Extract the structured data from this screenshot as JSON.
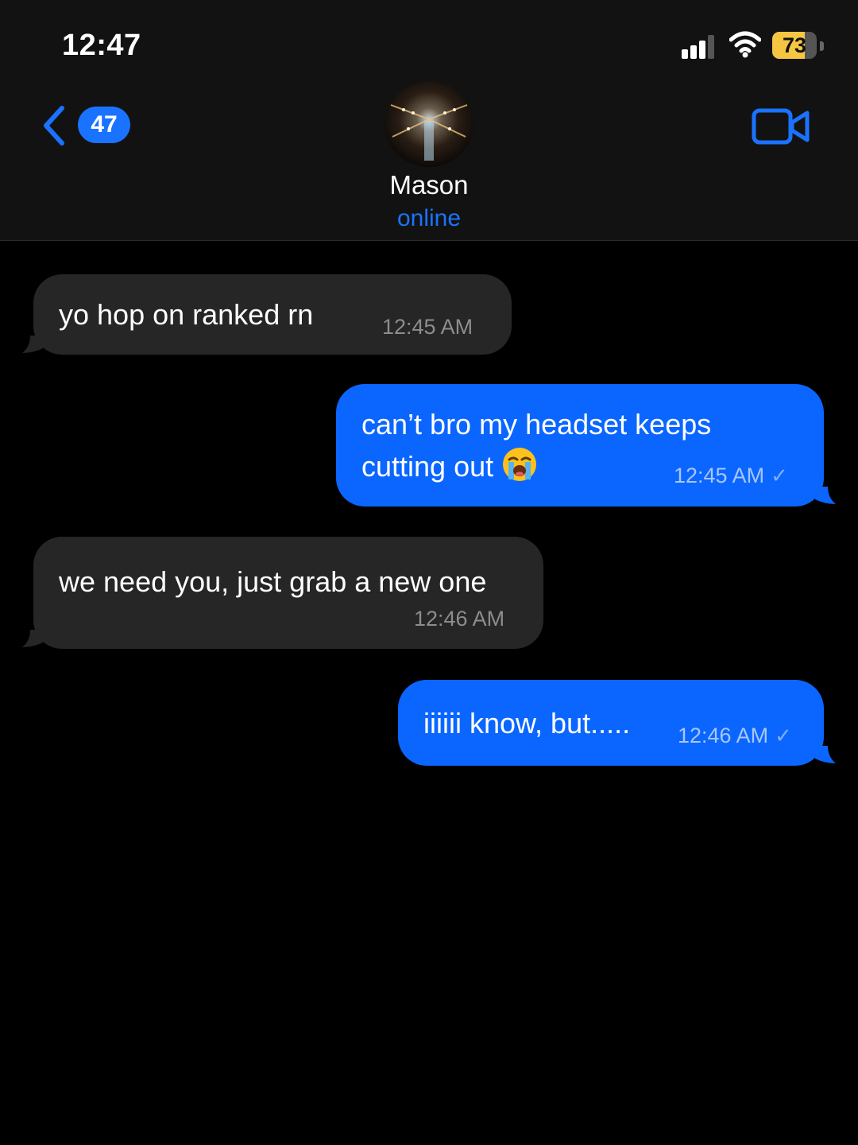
{
  "status_bar": {
    "time": "12:47",
    "battery_percent": "73"
  },
  "header": {
    "unread_count": "47",
    "contact_name": "Mason",
    "contact_status": "online"
  },
  "messages": [
    {
      "direction": "incoming",
      "text": "yo hop on ranked rn",
      "time": "12:45 AM"
    },
    {
      "direction": "outgoing",
      "text_line1": "can’t bro my headset keeps",
      "text_line2": "cutting out",
      "emoji": "loudly-crying-face",
      "time": "12:45 AM",
      "read_mark": "✓"
    },
    {
      "direction": "incoming",
      "text": "we need you, just grab a new one",
      "time": "12:46 AM"
    },
    {
      "direction": "outgoing",
      "text": "iiiiii know, but.....",
      "time": "12:46 AM",
      "read_mark": "✓"
    }
  ],
  "colors": {
    "accent": "#1a73ff",
    "outgoing_bubble": "#0a66ff",
    "incoming_bubble": "#262626",
    "battery": "#f6c643"
  }
}
